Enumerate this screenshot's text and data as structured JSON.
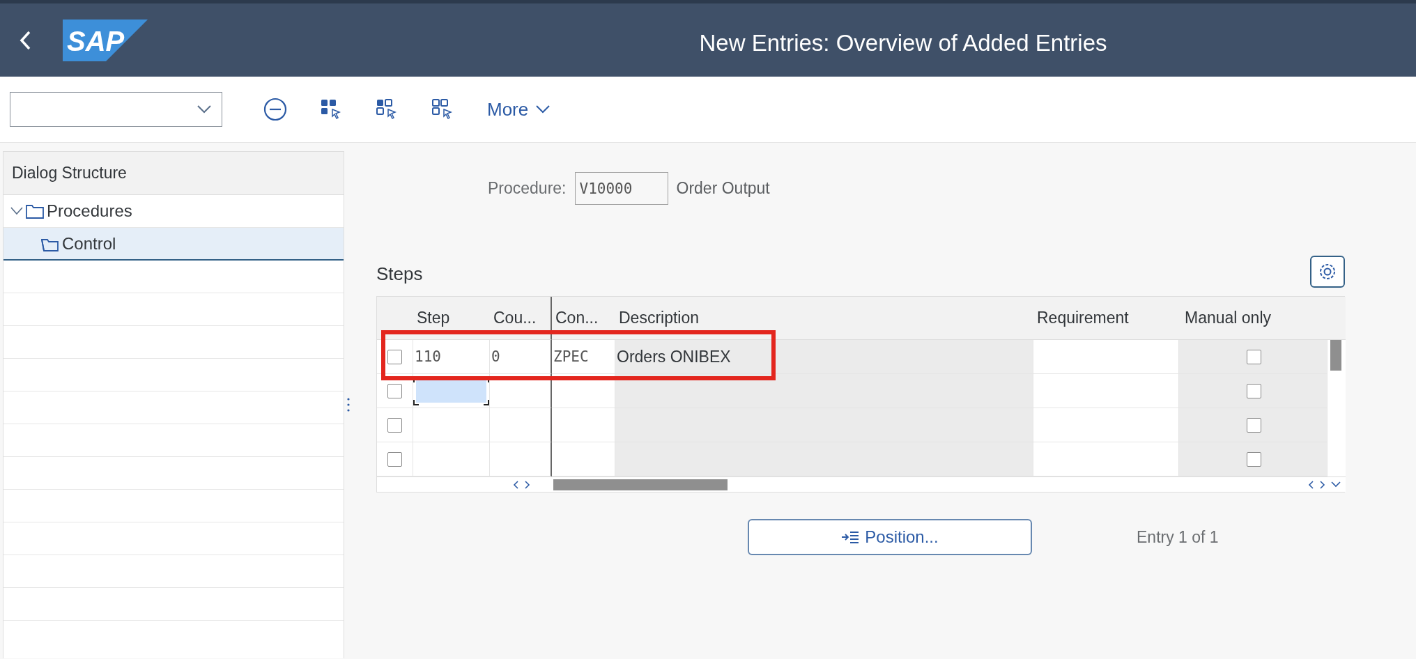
{
  "header": {
    "title": "New Entries: Overview of Added Entries",
    "logo": "SAP"
  },
  "toolbar": {
    "more": "More"
  },
  "dialog_structure": {
    "title": "Dialog Structure",
    "items": [
      {
        "label": "Procedures",
        "expanded": true,
        "selected": false,
        "children": [
          {
            "label": "Control",
            "selected": true
          }
        ]
      }
    ]
  },
  "procedure": {
    "label": "Procedure:",
    "value": "V10000",
    "description": "Order Output"
  },
  "steps": {
    "title": "Steps",
    "columns": [
      {
        "label": "Step",
        "kind": "input"
      },
      {
        "label": "Cou...",
        "kind": "input"
      },
      {
        "label": "Con...",
        "kind": "input"
      },
      {
        "label": "Description",
        "kind": "display"
      },
      {
        "label": "Requirement",
        "kind": "input"
      },
      {
        "label": "Manual only",
        "kind": "check"
      }
    ],
    "rows": [
      {
        "selected": false,
        "step_focused": false,
        "cells": [
          "110",
          "0",
          "ZPEC",
          "Orders ONIBEX",
          ""
        ],
        "manual_only": false,
        "highlighted": true
      },
      {
        "selected": false,
        "step_focused": true,
        "cells": [
          "",
          "",
          "",
          "",
          ""
        ],
        "manual_only": false,
        "highlighted": false
      },
      {
        "selected": false,
        "step_focused": false,
        "cells": [
          "",
          "",
          "",
          "",
          ""
        ],
        "manual_only": false,
        "highlighted": false
      },
      {
        "selected": false,
        "step_focused": false,
        "cells": [
          "",
          "",
          "",
          "",
          ""
        ],
        "manual_only": false,
        "highlighted": false
      }
    ]
  },
  "position_button": {
    "label": "Position..."
  },
  "entry_info": "Entry 1 of 1"
}
